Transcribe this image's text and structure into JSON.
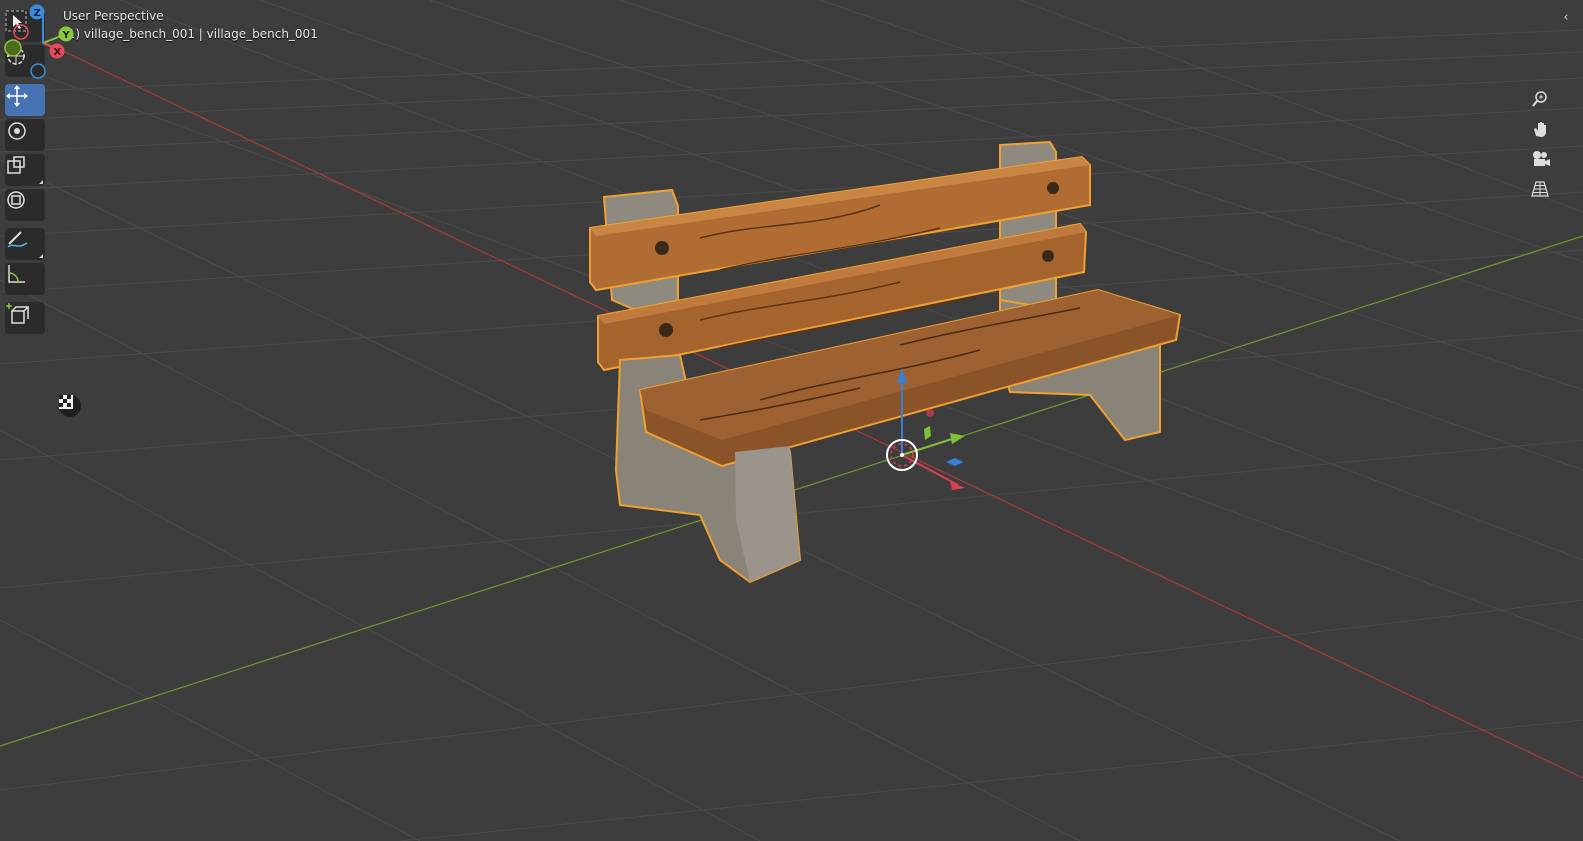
{
  "viewport": {
    "view_name": "User Perspective",
    "object_info": "(1) village_bench_001 | village_bench_001",
    "background_color": "#3d3d3d",
    "grid_color": "#4a4a4a",
    "x_axis_color": "#a83a3a",
    "y_axis_color": "#6f9a2e",
    "selection_outline_color": "#f0a030"
  },
  "toolbar": {
    "tools": [
      {
        "name": "select-box",
        "icon": "cursor-arrow-icon",
        "active": false
      },
      {
        "name": "cursor",
        "icon": "crosshair-cursor-icon",
        "active": false
      },
      {
        "name": "move",
        "icon": "move-arrows-icon",
        "active": true
      },
      {
        "name": "rotate",
        "icon": "rotate-icon",
        "active": false
      },
      {
        "name": "scale",
        "icon": "scale-icon",
        "active": false
      },
      {
        "name": "transform",
        "icon": "transform-icon",
        "active": false
      },
      {
        "name": "annotate",
        "icon": "annotate-pencil-icon",
        "active": false
      },
      {
        "name": "measure",
        "icon": "measure-ruler-icon",
        "active": false
      },
      {
        "name": "add-cube",
        "icon": "add-cube-icon",
        "active": false
      }
    ]
  },
  "navigation_gizmo": {
    "x_label": "X",
    "y_label": "Y",
    "z_label": "Z",
    "x_color": "#e34c5a",
    "y_color": "#8cc63f",
    "z_color": "#3a8dde"
  },
  "nav_buttons": [
    {
      "name": "zoom",
      "icon": "zoom-magnifier-icon"
    },
    {
      "name": "pan",
      "icon": "hand-pan-icon"
    },
    {
      "name": "camera-view",
      "icon": "camera-icon"
    },
    {
      "name": "orthographic-toggle",
      "icon": "grid-perspective-icon"
    }
  ],
  "shading_toggle_icon": "checker-icon",
  "collapse_icon": "chevron-left-icon",
  "collapse_glyph": "‹"
}
